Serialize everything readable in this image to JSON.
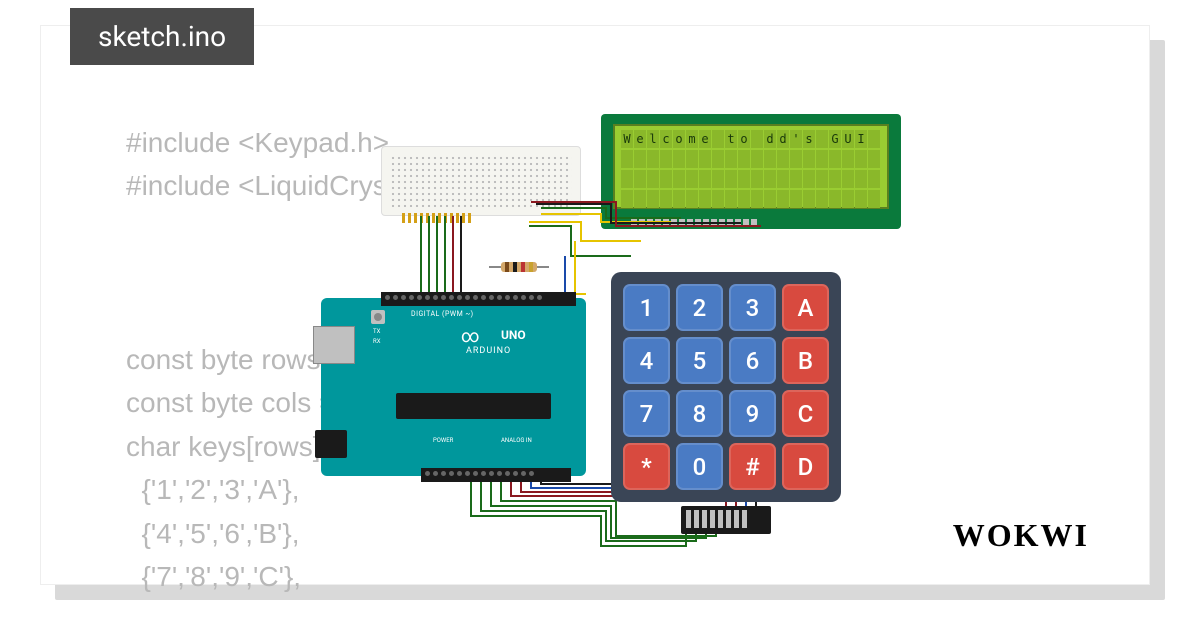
{
  "tab": {
    "filename": "sketch.ino"
  },
  "code": {
    "lines": [
      "#include <Keypad.h>",
      "#include <LiquidCryst",
      "",
      "",
      "",
      "const byte rows = 4; //four",
      "const byte cols = 4; //f                s",
      "char keys[rows][cols] =",
      "  {'1','2','3','A'},",
      "  {'4','5','6','B'},",
      "  {'7','8','9','C'},"
    ]
  },
  "lcd": {
    "text": "Welcome to dd's GUI",
    "rows": 4,
    "cols": 20
  },
  "arduino": {
    "model": "UNO",
    "brand": "ARDUINO",
    "header_label": "DIGITAL (PWM ~)",
    "tx": "TX",
    "rx": "RX",
    "power_label": "POWER",
    "analog_label": "ANALOG IN"
  },
  "keypad": {
    "keys": [
      {
        "label": "1",
        "cls": "blue"
      },
      {
        "label": "2",
        "cls": "blue"
      },
      {
        "label": "3",
        "cls": "blue"
      },
      {
        "label": "A",
        "cls": "red"
      },
      {
        "label": "4",
        "cls": "blue"
      },
      {
        "label": "5",
        "cls": "blue"
      },
      {
        "label": "6",
        "cls": "blue"
      },
      {
        "label": "B",
        "cls": "red"
      },
      {
        "label": "7",
        "cls": "blue"
      },
      {
        "label": "8",
        "cls": "blue"
      },
      {
        "label": "9",
        "cls": "blue"
      },
      {
        "label": "C",
        "cls": "red"
      },
      {
        "label": "*",
        "cls": "red"
      },
      {
        "label": "0",
        "cls": "blue"
      },
      {
        "label": "#",
        "cls": "red"
      },
      {
        "label": "D",
        "cls": "red"
      }
    ]
  },
  "brand": {
    "logo": "WOKWI"
  }
}
